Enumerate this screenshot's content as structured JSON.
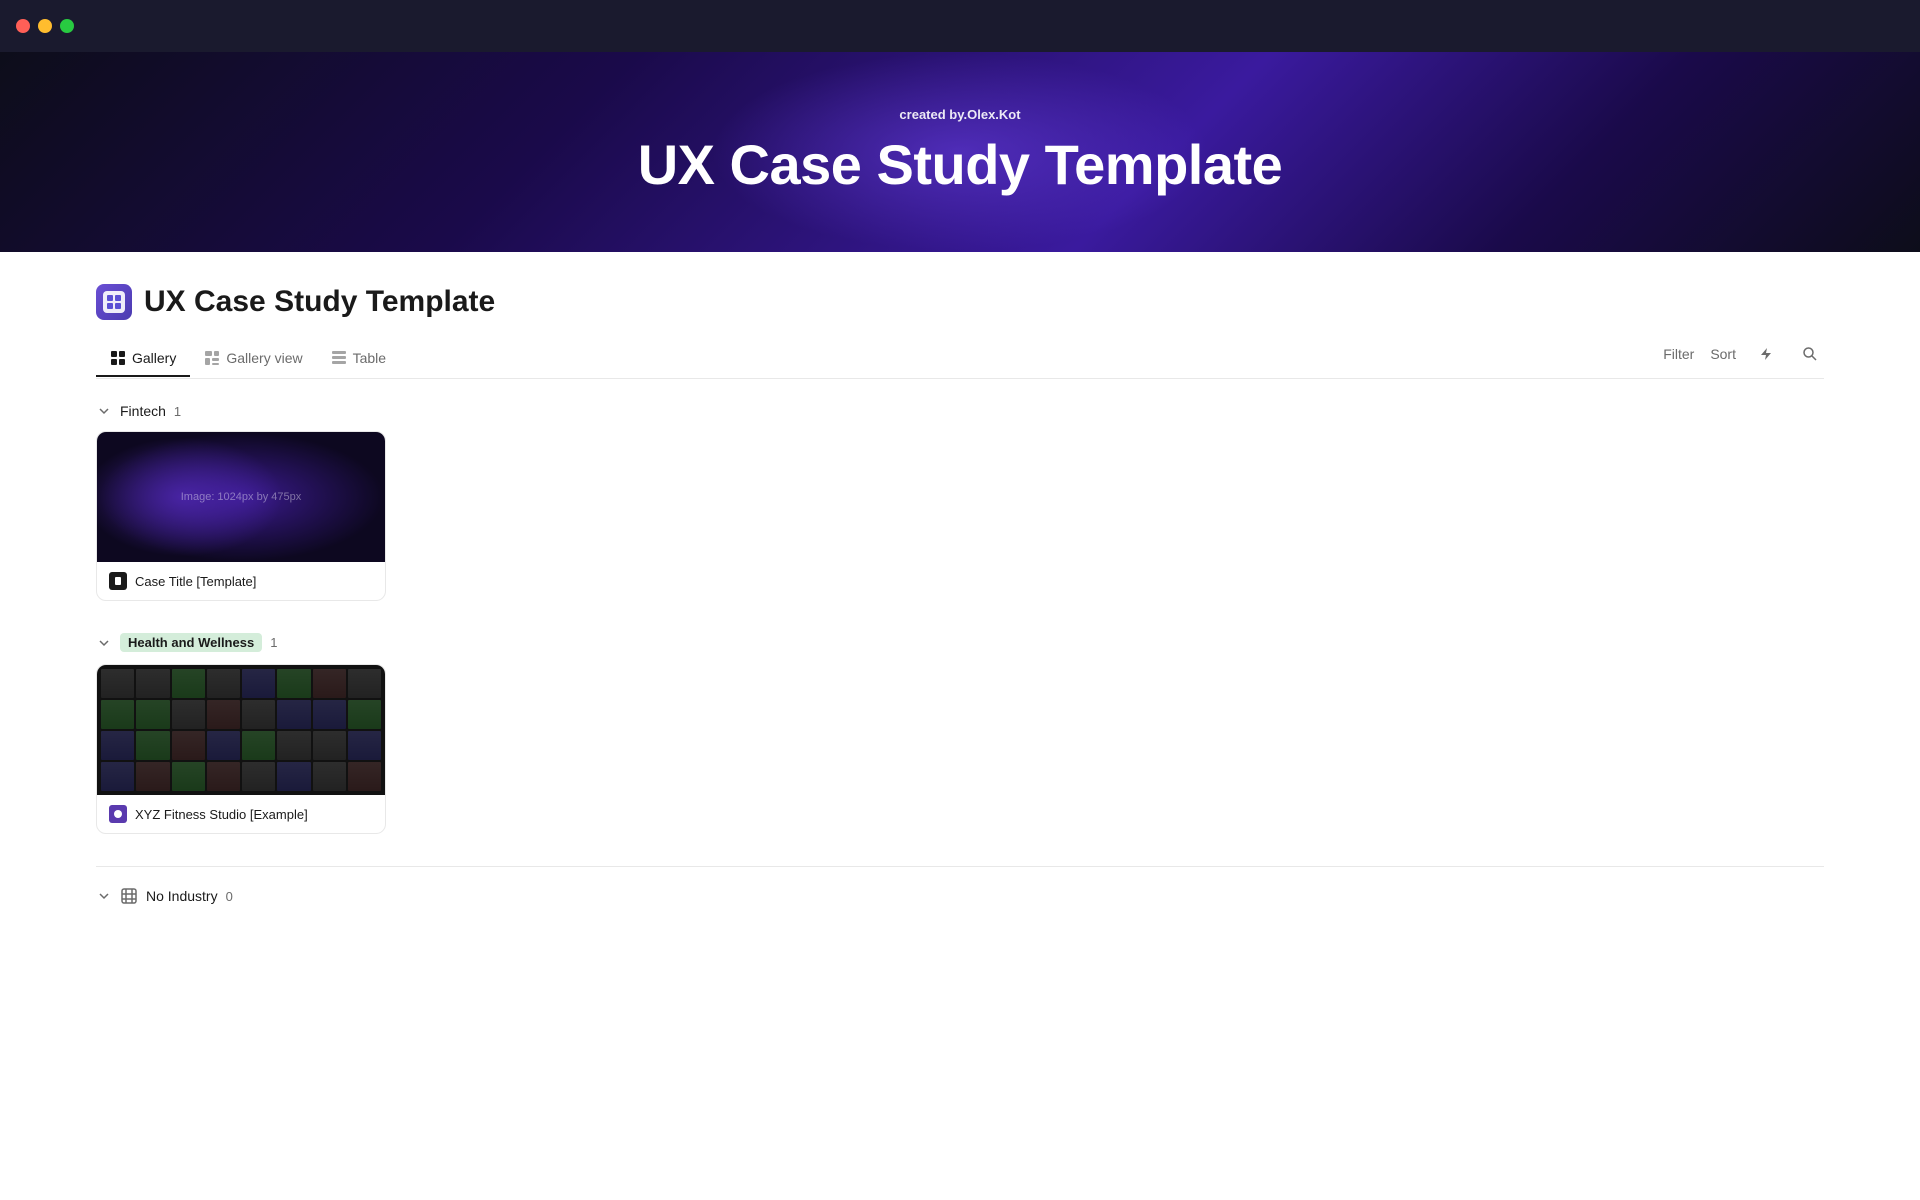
{
  "titlebar": {
    "btn_close_color": "#ff5f57",
    "btn_min_color": "#ffbd2e",
    "btn_max_color": "#28ca41"
  },
  "hero": {
    "credit_prefix": "created by.",
    "credit_name": "Olex.Kot",
    "title": "UX Case Study Template"
  },
  "page": {
    "icon_alt": "UX Case Study Template icon",
    "title": "UX Case Study Template"
  },
  "tabs": [
    {
      "id": "gallery",
      "label": "Gallery",
      "icon": "grid-icon",
      "active": true
    },
    {
      "id": "gallery-view",
      "label": "Gallery view",
      "icon": "gallery-icon",
      "active": false
    },
    {
      "id": "table",
      "label": "Table",
      "icon": "table-icon",
      "active": false
    }
  ],
  "toolbar": {
    "filter_label": "Filter",
    "sort_label": "Sort"
  },
  "groups": [
    {
      "id": "fintech",
      "label": "Fintech",
      "tag_style": "plain",
      "count": 1,
      "cards": [
        {
          "id": "case-template",
          "image_type": "fintech",
          "image_placeholder": "Image: 1024px by 475px",
          "icon_type": "dark",
          "label": "Case Title [Template]"
        }
      ]
    },
    {
      "id": "health-wellness",
      "label": "Health and Wellness",
      "tag_style": "green",
      "count": 1,
      "cards": [
        {
          "id": "xyz-fitness",
          "image_type": "fitness",
          "image_placeholder": "",
          "icon_type": "purple",
          "label": "XYZ Fitness Studio [Example]"
        }
      ]
    },
    {
      "id": "no-industry",
      "label": "No Industry",
      "tag_style": "plain",
      "count": 0,
      "cards": []
    }
  ]
}
